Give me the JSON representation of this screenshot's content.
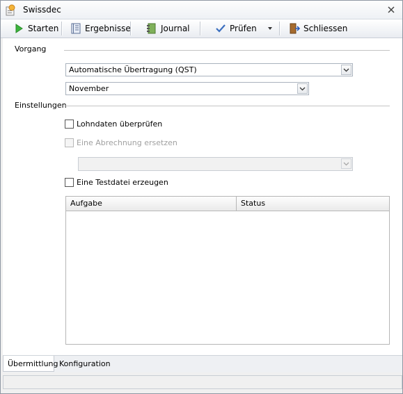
{
  "window": {
    "title": "Swissdec"
  },
  "toolbar": {
    "start_label": "Starten",
    "results_label": "Ergebnisse",
    "journal_label": "Journal",
    "check_label": "Prüfen",
    "close_label": "Schliessen"
  },
  "vorgang": {
    "label": "Vorgang",
    "type_value": "Automatische Übertragung (QST)",
    "month_value": "November"
  },
  "einstellungen": {
    "label": "Einstellungen",
    "check_payroll_label": "Lohndaten überprüfen",
    "check_payroll_checked": false,
    "replace_label": "Eine Abrechnung ersetzen",
    "replace_checked": false,
    "replace_select_value": "",
    "testfile_label": "Eine Testdatei erzeugen",
    "testfile_checked": false
  },
  "grid": {
    "columns": [
      "Aufgabe",
      "Status"
    ],
    "rows": []
  },
  "tabs": [
    "Übermittlung",
    "Konfiguration"
  ],
  "active_tab": "Übermittlung"
}
